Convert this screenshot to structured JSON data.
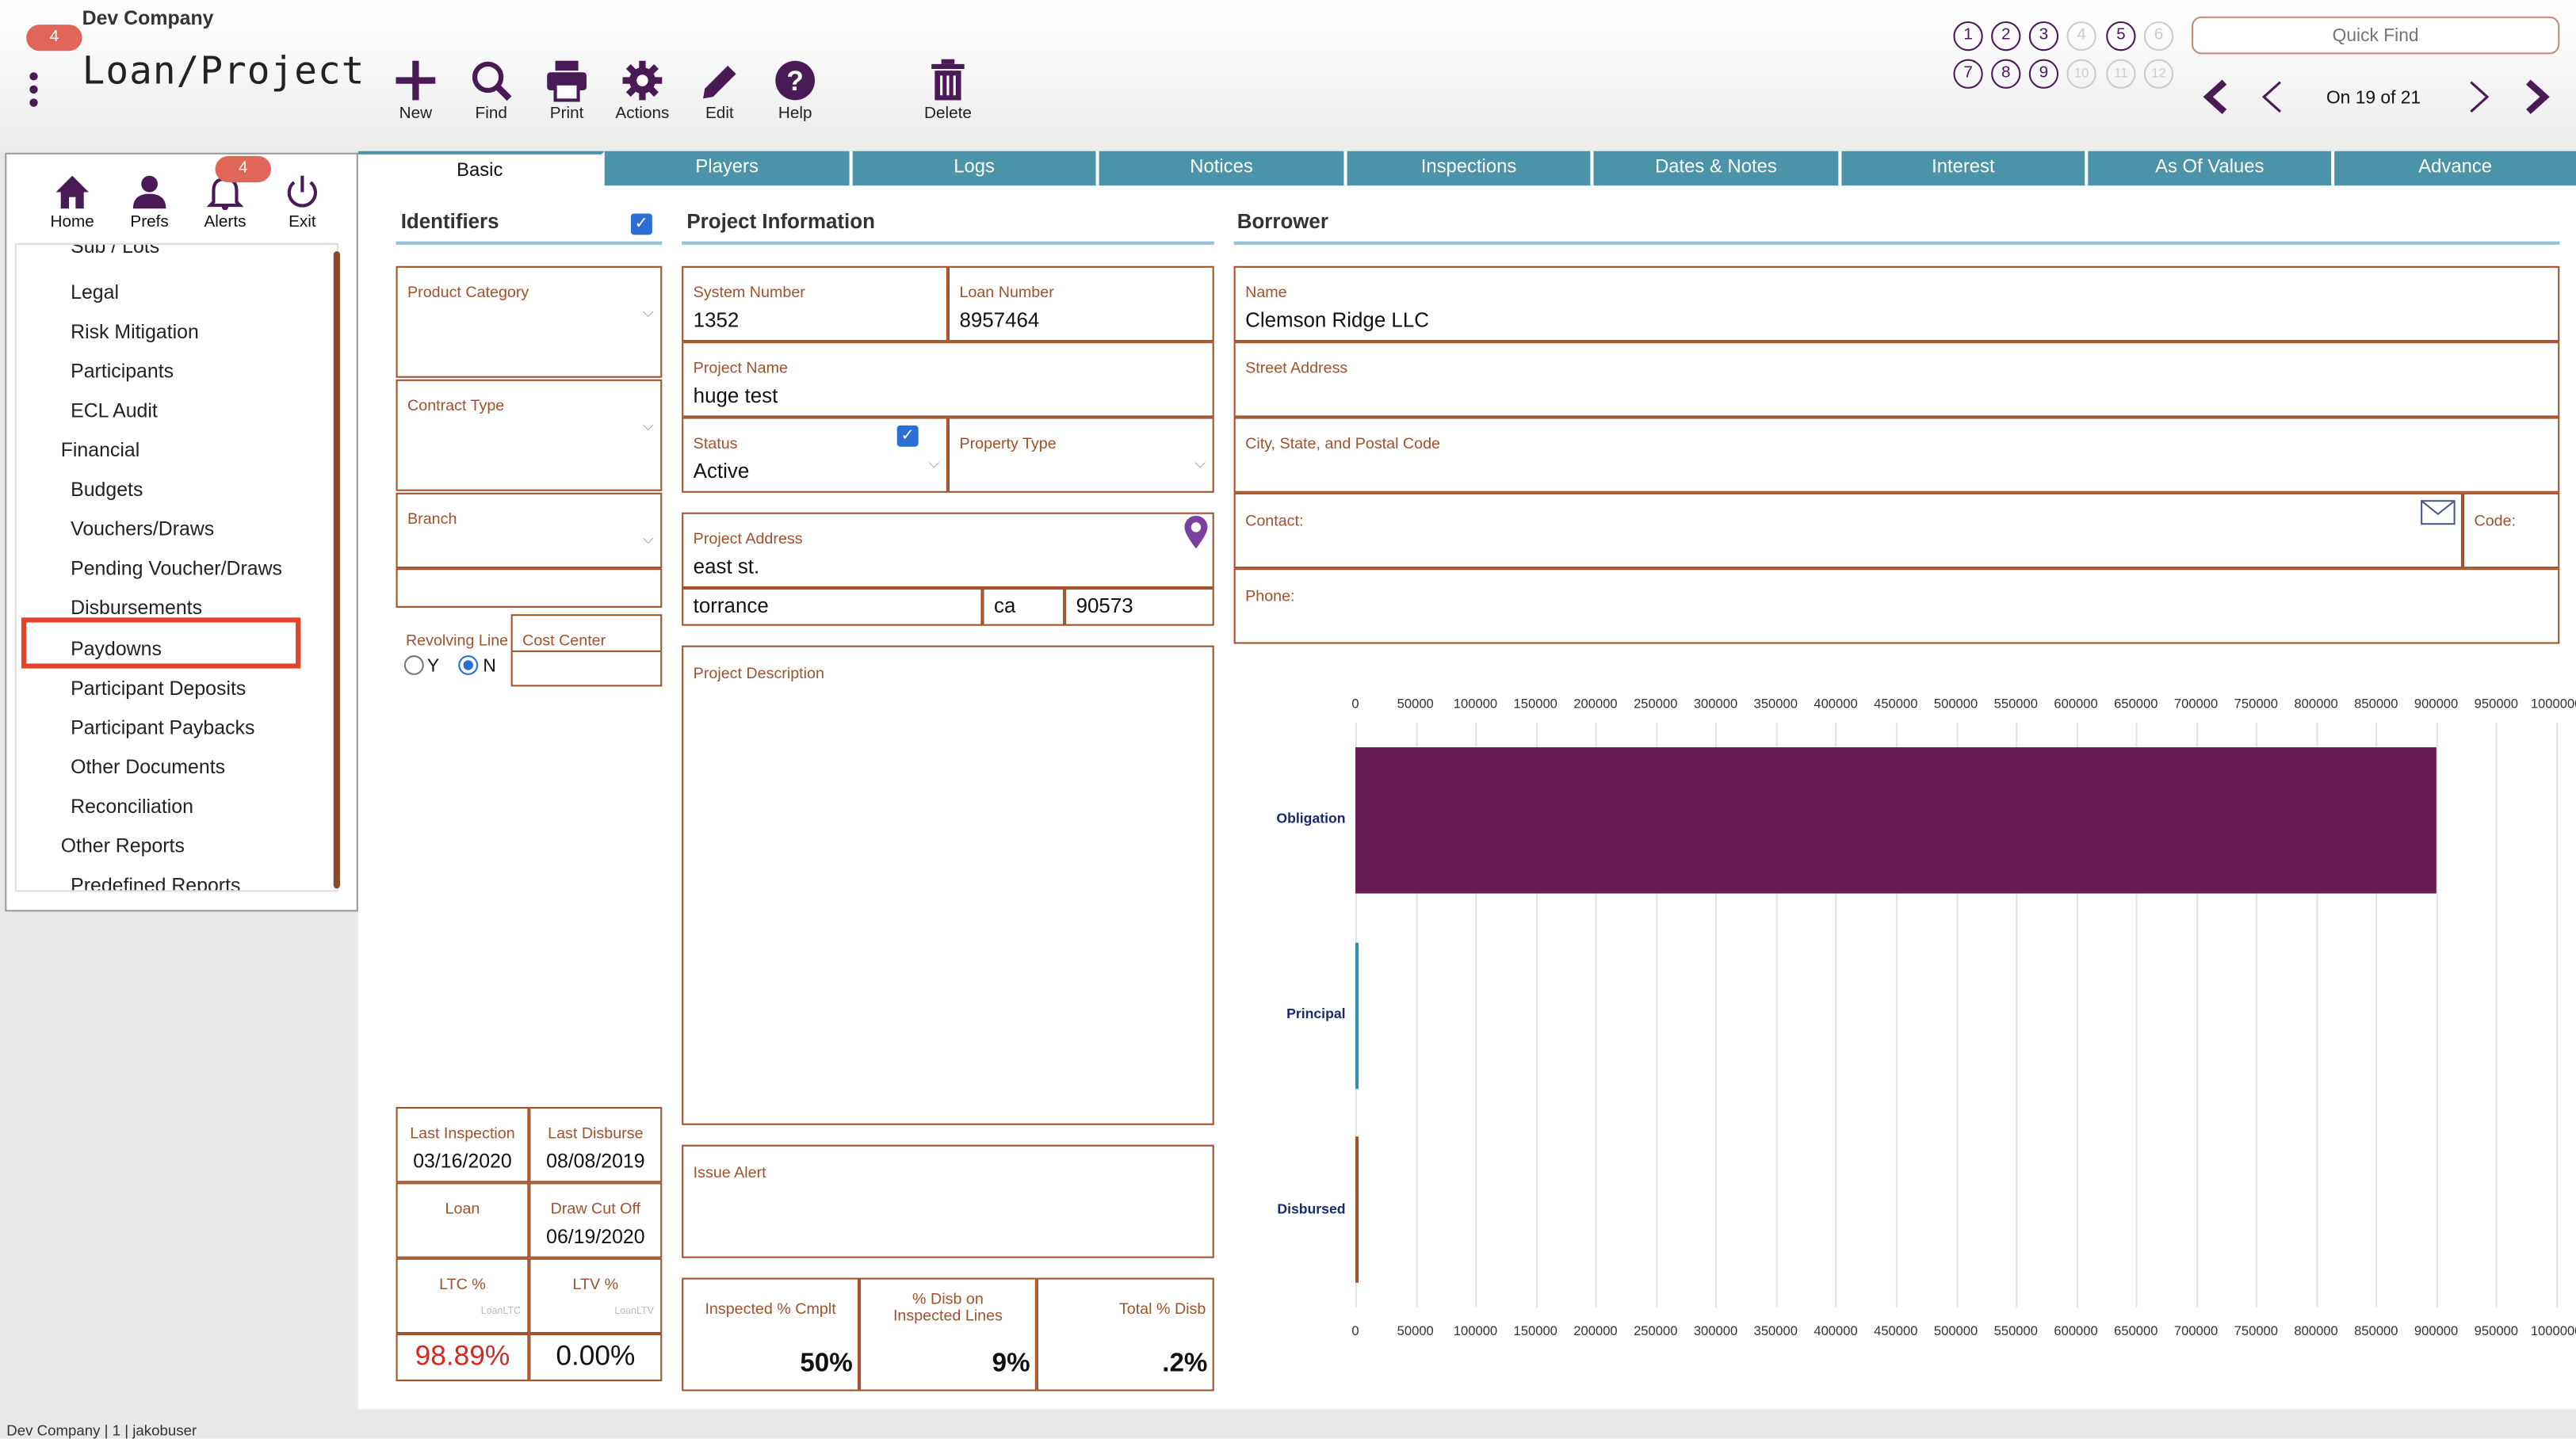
{
  "header": {
    "company": "Dev Company",
    "title": "Loan/Project",
    "badge_count": "4",
    "quick_find_placeholder": "Quick Find",
    "record_position": "On 19 of 21"
  },
  "toolbar": {
    "new": "New",
    "find": "Find",
    "print": "Print",
    "actions": "Actions",
    "edit": "Edit",
    "help": "Help",
    "delete": "Delete"
  },
  "circles": {
    "row1": [
      "1",
      "2",
      "3",
      "4",
      "5",
      "6"
    ],
    "row2": [
      "7",
      "8",
      "9",
      "10",
      "11",
      "12"
    ]
  },
  "tabs": [
    "Basic",
    "Players",
    "Logs",
    "Notices",
    "Inspections",
    "Dates & Notes",
    "Interest",
    "As Of Values",
    "Advance"
  ],
  "left_panel": {
    "home": "Home",
    "prefs": "Prefs",
    "alerts": "Alerts",
    "exit": "Exit",
    "alerts_badge": "4",
    "items": [
      "Sub / Lots",
      "Legal",
      "Risk Mitigation",
      "Participants",
      "ECL Audit",
      "Financial",
      "Budgets",
      "Vouchers/Draws",
      "Pending Voucher/Draws",
      "Disbursements",
      "Paydowns",
      "Participant Deposits",
      "Participant Paybacks",
      "Other Documents",
      "Reconciliation",
      "Other Reports",
      "Predefined Reports"
    ]
  },
  "identifiers": {
    "title": "Identifiers",
    "product_category": "Product Category",
    "contract_type": "Contract Type",
    "branch": "Branch",
    "revolving_line": "Revolving Line",
    "y": "Y",
    "n": "N",
    "cost_center": "Cost Center",
    "last_inspection_label": "Last Inspection",
    "last_inspection": "03/16/2020",
    "last_disburse_label": "Last Disburse",
    "last_disburse": "08/08/2019",
    "loan_label": "Loan",
    "draw_cut_off_label": "Draw Cut Off",
    "draw_cut_off": "06/19/2020",
    "ltc_label": "LTC %",
    "ltv_label": "LTV %",
    "ltc_hint": "LoanLTC",
    "ltv_hint": "LoanLTV",
    "ltc": "98.89%",
    "ltv": "0.00%"
  },
  "project": {
    "title": "Project Information",
    "system_number_label": "System Number",
    "system_number": "1352",
    "loan_number_label": "Loan Number",
    "loan_number": "8957464",
    "project_name_label": "Project Name",
    "project_name": "huge test",
    "status_label": "Status",
    "status": "Active",
    "property_type_label": "Property Type",
    "project_address_label": "Project Address",
    "address": "east st.",
    "city": "torrance",
    "state": "ca",
    "zip": "90573",
    "description_label": "Project Description",
    "issue_alert_label": "Issue Alert",
    "inspected_cmplt_label": "Inspected % Cmplt",
    "disb_inspected_label": "% Disb on Inspected Lines",
    "total_disb_label": "Total % Disb",
    "inspected_cmplt": "50%",
    "disb_inspected": "9%",
    "total_disb": ".2%"
  },
  "borrower": {
    "title": "Borrower",
    "name_label": "Name",
    "name": "Clemson Ridge LLC",
    "street_label": "Street Address",
    "city_label": "City, State, and Postal Code",
    "contact_label": "Contact:",
    "code_label": "Code:",
    "phone_label": "Phone:"
  },
  "chart_data": {
    "type": "bar",
    "orientation": "horizontal",
    "categories": [
      "Obligation",
      "Principal",
      "Disbursed"
    ],
    "values": [
      900000,
      2000,
      1000
    ],
    "xlim": [
      0,
      1000000
    ],
    "ticks": [
      0,
      50000,
      100000,
      150000,
      200000,
      250000,
      300000,
      350000,
      400000,
      450000,
      500000,
      550000,
      600000,
      650000,
      700000,
      750000,
      800000,
      850000,
      900000,
      950000,
      1000000
    ],
    "colors": [
      "#661c55",
      "#2e8fa8",
      "#a0522d"
    ],
    "grid": true
  },
  "footer": {
    "status": "Dev Company | 1 | jakobuser"
  },
  "colors": {
    "accent": "#4a1a57",
    "tab": "#4a93a8",
    "field_border": "#a0522d",
    "badge": "#e0665a",
    "highlight": "#e0442a"
  }
}
